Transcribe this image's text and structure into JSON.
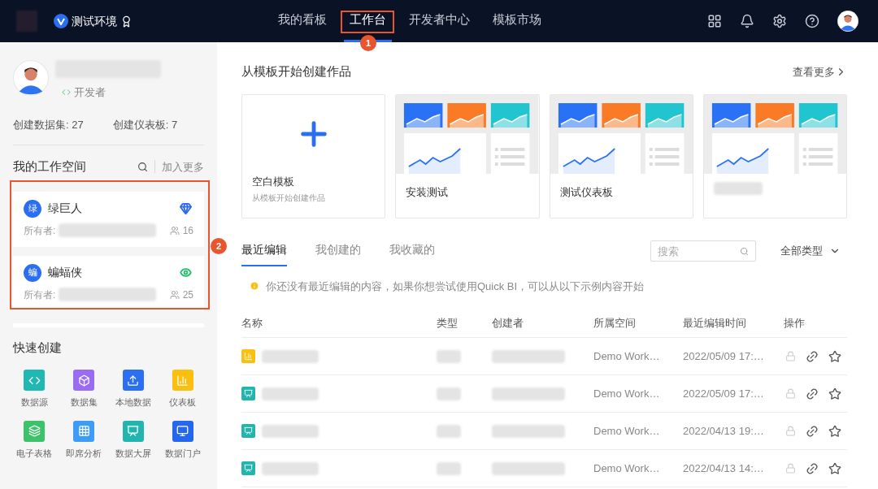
{
  "header": {
    "env_name": "测试环境",
    "nav": [
      {
        "label": "我的看板",
        "selected": false
      },
      {
        "label": "工作台",
        "selected": true
      },
      {
        "label": "开发者中心",
        "selected": false
      },
      {
        "label": "模板市场",
        "selected": false
      }
    ]
  },
  "annotations": [
    {
      "label": "1"
    },
    {
      "label": "2"
    }
  ],
  "profile": {
    "role": "开发者",
    "stats": [
      "创建数据集: 27",
      "创建仪表板: 7"
    ]
  },
  "workspaces": {
    "title": "我的工作空间",
    "join": "加入更多",
    "items": [
      {
        "avatar_char": "绿",
        "name": "绿巨人",
        "owner_label": "所有者:",
        "members": "16",
        "kind": "gem",
        "color": "#2f6bf0"
      },
      {
        "avatar_char": "蝙",
        "name": "蝙蝠侠",
        "owner_label": "所有者:",
        "members": "25",
        "kind": "eye",
        "color": "#20c06a"
      }
    ]
  },
  "quick_create": {
    "title": "快速创建",
    "items": [
      {
        "label": "数据源",
        "kind": "code",
        "color": "#1fb8b2"
      },
      {
        "label": "数据集",
        "kind": "box",
        "color": "#9a6cf2"
      },
      {
        "label": "本地数据",
        "kind": "upload",
        "color": "#2b6ff2"
      },
      {
        "label": "仪表板",
        "kind": "bars",
        "color": "#fbbf0f"
      },
      {
        "label": "电子表格",
        "kind": "layers",
        "color": "#3cc36a"
      },
      {
        "label": "即席分析",
        "kind": "grid",
        "color": "#3d9cf5"
      },
      {
        "label": "数据大屏",
        "kind": "screen",
        "color": "#22b5ae"
      },
      {
        "label": "数据门户",
        "kind": "monitor",
        "color": "#2467ee"
      }
    ]
  },
  "templates": {
    "title": "从模板开始创建作品",
    "more": "查看更多",
    "cards": [
      {
        "kind": "blank",
        "title": "空白模板",
        "subtitle": "从模板开始创建作品"
      },
      {
        "kind": "picture",
        "title": "安装测试"
      },
      {
        "kind": "picture",
        "title": "测试仪表板"
      },
      {
        "kind": "picture"
      }
    ]
  },
  "tabs": [
    {
      "label": "最近编辑",
      "selected": true
    },
    {
      "label": "我创建的",
      "selected": false
    },
    {
      "label": "我收藏的",
      "selected": false
    }
  ],
  "search": {
    "placeholder": "搜索"
  },
  "type_filter": "全部类型",
  "notice": "你还没有最近编辑的内容，如果你想尝试使用Quick BI，可以从以下示例内容开始",
  "table": {
    "columns": [
      "名称",
      "类型",
      "创建者",
      "所属空间",
      "最近编辑时间",
      "操作"
    ],
    "rows": [
      {
        "kind": "dashboard",
        "space": "Demo Work…",
        "edited": "2022/05/09 17:…",
        "starred": false
      },
      {
        "kind": "screen",
        "space": "Demo Work…",
        "edited": "2022/05/09 17:…",
        "starred": false
      },
      {
        "kind": "screen",
        "space": "Demo Work…",
        "edited": "2022/04/13 19:…",
        "starred": false
      },
      {
        "kind": "screen",
        "space": "Demo Work…",
        "edited": "2022/04/13 14:…",
        "starred": false
      }
    ]
  }
}
